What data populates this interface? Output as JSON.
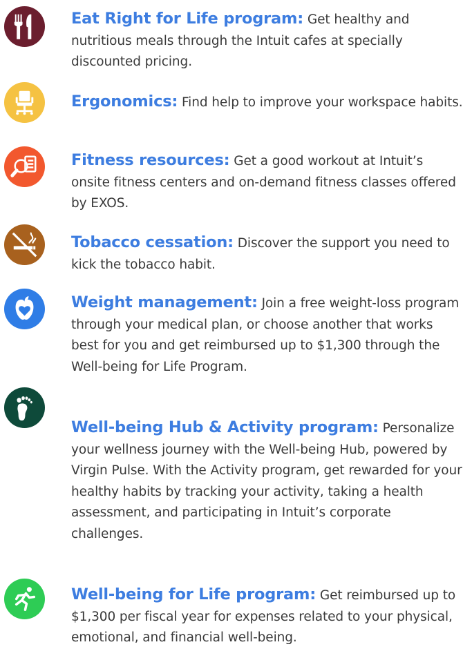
{
  "colors": {
    "title_blue": "#3d7de0",
    "body_text": "#3a3a3a",
    "eat_icon": "#6b1e2e",
    "ergo_icon": "#f5c242",
    "fitness_icon": "#f2582e",
    "tobacco_icon": "#a8611e",
    "weight_icon": "#2f7de6",
    "hub_icon": "#0e4a3a",
    "life_icon": "#2ecc55"
  },
  "items": [
    {
      "icon": "fork-knife-icon",
      "title": "Eat Right for Life program:",
      "body": "Get healthy and nutritious meals through the Intuit cafes at specially discounted pricing."
    },
    {
      "icon": "office-chair-icon",
      "title": "Ergonomics:",
      "body": "Find help to improve your workspace habits."
    },
    {
      "icon": "fitness-checklist-icon",
      "title": "Fitness resources:",
      "body": "Get a good workout at Intuit’s onsite fitness centers and on-demand fitness classes offered by EXOS."
    },
    {
      "icon": "no-smoking-icon",
      "title": "Tobacco cessation:",
      "body": "Discover the support you need to kick the tobacco habit."
    },
    {
      "icon": "apple-heart-icon",
      "title": "Weight management:",
      "body": "Join a free weight-loss program through your medical plan, or choose another that works best for you and get reimbursed up to $1,300 through the Well-being for Life Program."
    },
    {
      "icon": "footprint-icon",
      "title": "Well-being Hub & Activity program:",
      "body": "Personalize your wellness journey with the Well-being Hub, powered by Virgin Pulse. With the Activity program, get rewarded for your healthy habits by tracking your activity, taking a health assessment, and participating in Intuit’s corporate challenges."
    },
    {
      "icon": "running-person-icon",
      "title": "Well-being for Life program:",
      "body": "Get reimbursed up to $1,300 per fiscal year for expenses related to your physical, emotional, and financial well-being."
    }
  ]
}
